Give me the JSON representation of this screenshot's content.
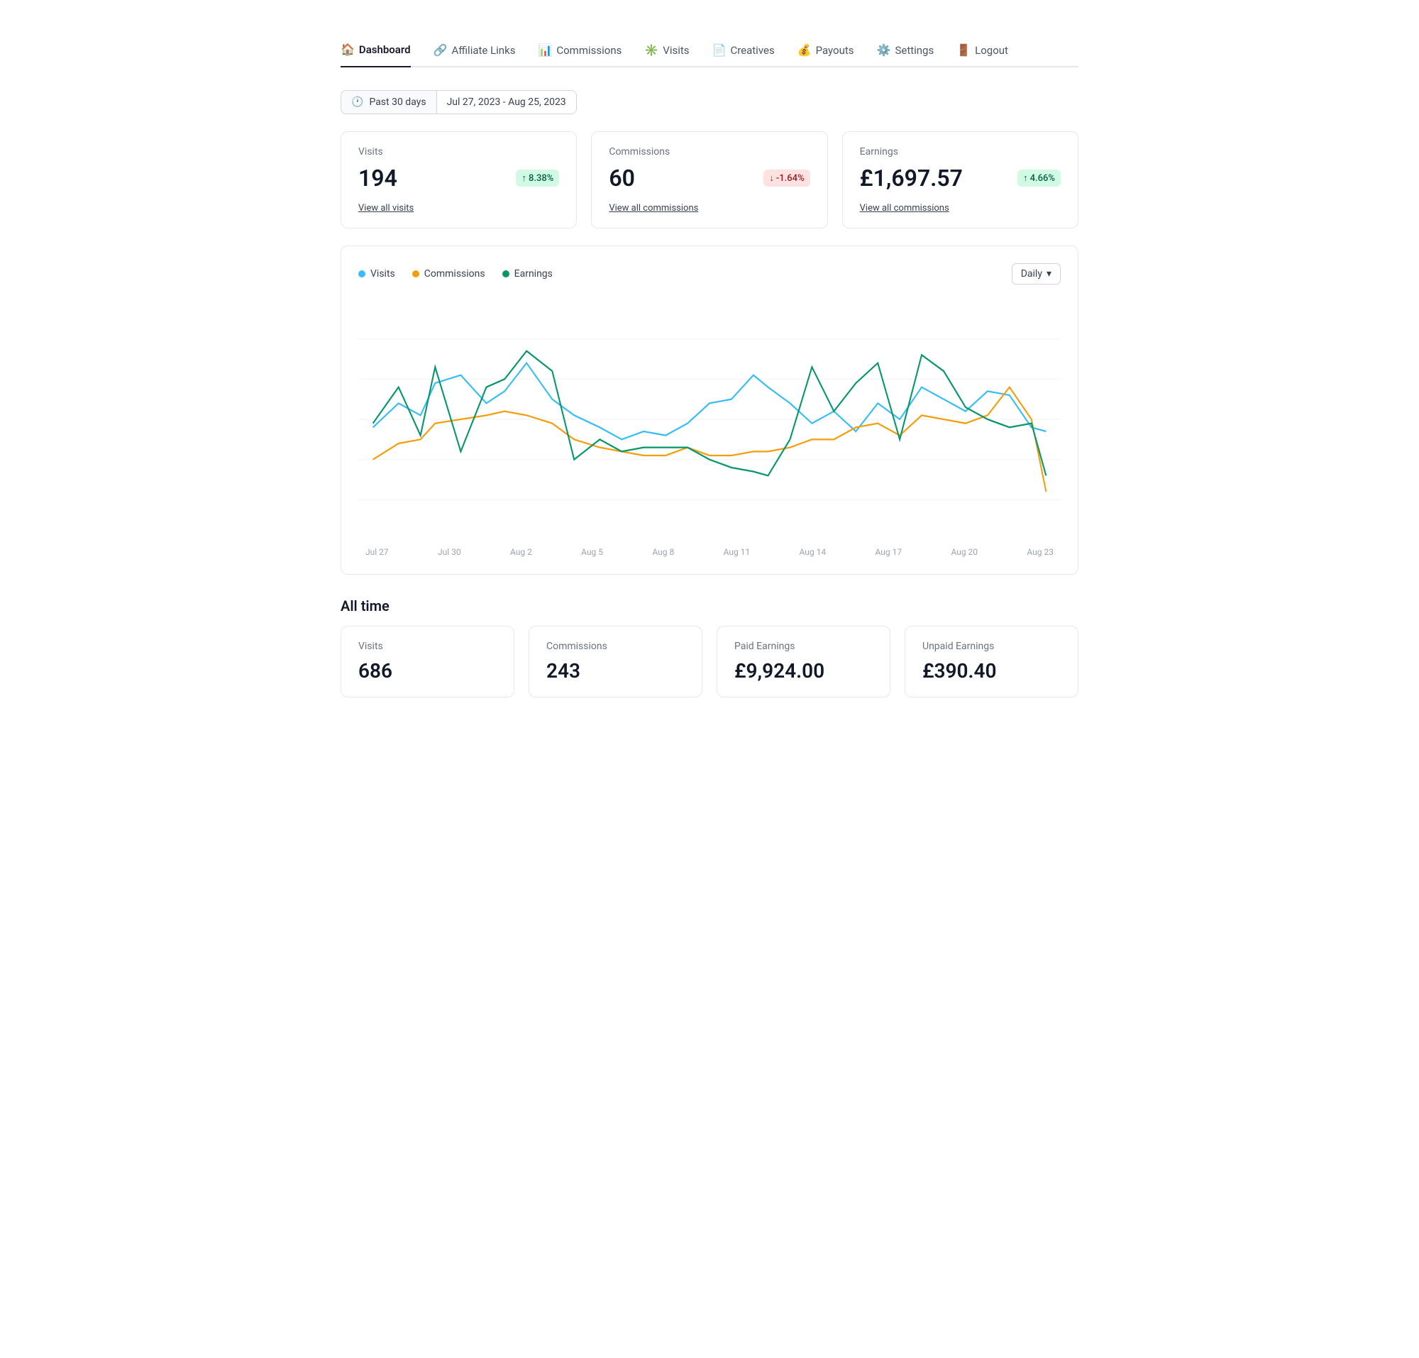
{
  "nav": {
    "items": [
      {
        "id": "dashboard",
        "label": "Dashboard",
        "icon": "🏠",
        "active": true
      },
      {
        "id": "affiliate-links",
        "label": "Affiliate Links",
        "icon": "🔗",
        "active": false
      },
      {
        "id": "commissions",
        "label": "Commissions",
        "icon": "📊",
        "active": false
      },
      {
        "id": "visits",
        "label": "Visits",
        "icon": "✳️",
        "active": false
      },
      {
        "id": "creatives",
        "label": "Creatives",
        "icon": "📄",
        "active": false
      },
      {
        "id": "payouts",
        "label": "Payouts",
        "icon": "💰",
        "active": false
      },
      {
        "id": "settings",
        "label": "Settings",
        "icon": "⚙️",
        "active": false
      },
      {
        "id": "logout",
        "label": "Logout",
        "icon": "🚪",
        "active": false
      }
    ]
  },
  "date_filter": {
    "period_label": "Past 30 days",
    "date_range": "Jul 27, 2023 - Aug 25, 2023",
    "clock_icon": "🕐"
  },
  "stats": {
    "visits": {
      "label": "Visits",
      "value": "194",
      "badge_text": "8.38%",
      "badge_type": "green",
      "badge_arrow": "↑",
      "link_text": "View all visits"
    },
    "commissions": {
      "label": "Commissions",
      "value": "60",
      "badge_text": "-1.64%",
      "badge_type": "red",
      "badge_arrow": "↓",
      "link_text": "View all commissions"
    },
    "earnings": {
      "label": "Earnings",
      "value": "£1,697.57",
      "badge_text": "4.66%",
      "badge_type": "green",
      "badge_arrow": "↑",
      "link_text": "View all commissions"
    }
  },
  "chart": {
    "legend": [
      {
        "label": "Visits",
        "color": "#38bdf8"
      },
      {
        "label": "Commissions",
        "color": "#f59e0b"
      },
      {
        "label": "Earnings",
        "color": "#059669"
      }
    ],
    "dropdown_label": "Daily",
    "x_labels": [
      "Jul 27",
      "Jul 30",
      "Aug 2",
      "Aug 5",
      "Aug 8",
      "Aug 11",
      "Aug 14",
      "Aug 17",
      "Aug 20",
      "Aug 23"
    ]
  },
  "alltime": {
    "title": "All time",
    "cards": [
      {
        "label": "Visits",
        "value": "686"
      },
      {
        "label": "Commissions",
        "value": "243"
      },
      {
        "label": "Paid Earnings",
        "value": "£9,924.00"
      },
      {
        "label": "Unpaid Earnings",
        "value": "£390.40"
      }
    ]
  }
}
